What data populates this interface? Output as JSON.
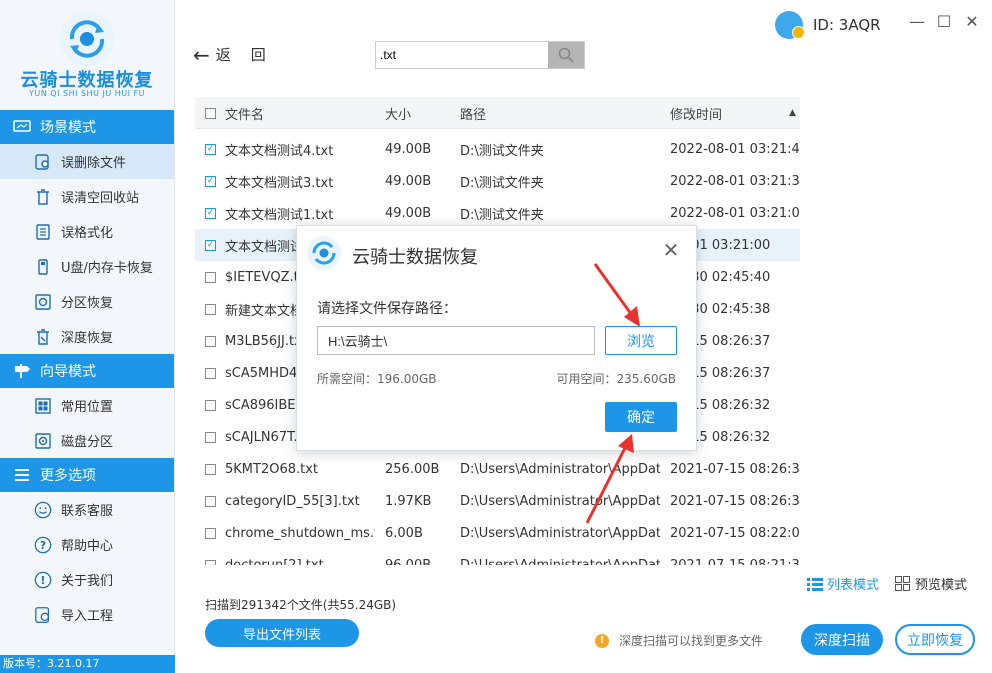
{
  "app": {
    "logo_title": "云骑士数据恢复",
    "logo_subtitle": "YUN QI SHI SHU JU HUI FU",
    "version": "版本号：3.21.0.17"
  },
  "topbar": {
    "user_id": "ID: 3AQR",
    "min": "—",
    "max": "☐",
    "close": "✕"
  },
  "sidebar": {
    "sections": [
      {
        "header": "场景模式",
        "items": [
          "误删除文件",
          "误清空回收站",
          "误格式化",
          "U盘/内存卡恢复",
          "分区恢复",
          "深度恢复"
        ]
      },
      {
        "header": "向导模式",
        "items": [
          "常用位置",
          "磁盘分区"
        ]
      },
      {
        "header": "更多选项",
        "items": [
          "联系客服",
          "帮助中心",
          "关于我们",
          "导入工程"
        ]
      }
    ]
  },
  "nav": {
    "back_arrow": "←",
    "back_1": "返",
    "back_2": "回"
  },
  "search": {
    "value": ".txt"
  },
  "table": {
    "headers": {
      "name": "文件名",
      "size": "大小",
      "path": "路径",
      "time": "修改时间"
    },
    "sort_indicator": "▲",
    "rows": [
      {
        "name": "文本文档测试4.txt",
        "size": "49.00B",
        "path": "D:\\测试文件夹",
        "time": "2022-08-01 03:21:46",
        "checked": true
      },
      {
        "name": "文本文档测试3.txt",
        "size": "49.00B",
        "path": "D:\\测试文件夹",
        "time": "2022-08-01 03:21:33",
        "checked": true
      },
      {
        "name": "文本文档测试1.txt",
        "size": "49.00B",
        "path": "D:\\测试文件夹",
        "time": "2022-08-01 03:21:03",
        "checked": true
      },
      {
        "name": "文本文档测试",
        "size": "",
        "path": "",
        "time": "08-01 03:21:00",
        "checked": true
      },
      {
        "name": "$IETEVQZ.txt",
        "size": "",
        "path": "",
        "time": "07-30 02:45:40",
        "checked": false
      },
      {
        "name": "新建文本文档",
        "size": "",
        "path": "",
        "time": "07-30 02:45:38",
        "checked": false
      },
      {
        "name": "M3LB56JJ.txt",
        "size": "",
        "path": "",
        "time": "07-15 08:26:37",
        "checked": false
      },
      {
        "name": "sCA5MHD47",
        "size": "",
        "path": "",
        "time": "07-15 08:26:37",
        "checked": false
      },
      {
        "name": "sCA896IBE.tx",
        "size": "",
        "path": "",
        "time": "07-15 08:26:32",
        "checked": false
      },
      {
        "name": "sCAJLN67T.t",
        "size": "",
        "path": "",
        "time": "07-15 08:26:32",
        "checked": false
      },
      {
        "name": "5KMT2O68.txt",
        "size": "256.00B",
        "path": "D:\\Users\\Administrator\\AppData...",
        "time": "2021-07-15 08:26:32",
        "checked": false
      },
      {
        "name": "categoryID_55[3].txt",
        "size": "1.97KB",
        "path": "D:\\Users\\Administrator\\AppData...",
        "time": "2021-07-15 08:26:32",
        "checked": false
      },
      {
        "name": "chrome_shutdown_ms.txt",
        "size": "6.00B",
        "path": "D:\\Users\\Administrator\\AppData...",
        "time": "2021-07-15 08:22:09",
        "checked": false
      },
      {
        "name": "doctorun[2].txt",
        "size": "96.00B",
        "path": "D:\\Users\\Administrator\\AppData...",
        "time": "2021-07-15 08:21:39",
        "checked": false
      }
    ]
  },
  "view_modes": {
    "list": "列表模式",
    "preview": "预览模式"
  },
  "footer": {
    "scan_info": "扫描到291342个文件(共55.24GB)",
    "export_button": "导出文件列表",
    "tip": "深度扫描可以找到更多文件",
    "tip_icon": "!",
    "deep_scan_button": "深度扫描",
    "recover_button": "立即恢复"
  },
  "dialog": {
    "title": "云骑士数据恢复",
    "close": "✕",
    "label": "请选择文件保存路径：",
    "path_value": "H:\\云骑士\\",
    "browse_button": "浏览",
    "used_space": "所需空间：196.00GB",
    "free_space": "可用空间：235.60GB",
    "ok_button": "确定"
  },
  "colors": {
    "accent": "#1e96e8",
    "arrow": "#e8322f",
    "warning": "#f5a623"
  }
}
